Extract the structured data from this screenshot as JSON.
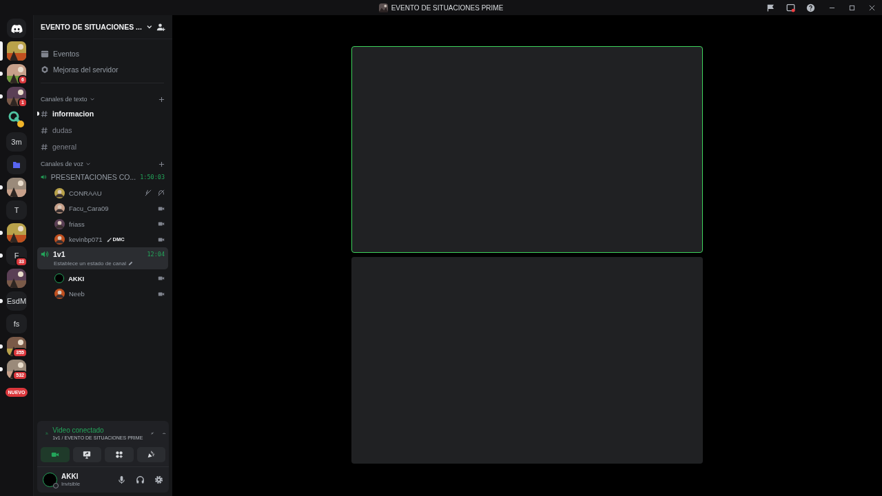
{
  "window": {
    "title": "EVENTO DE SITUACIONES PRIME"
  },
  "servers": [
    {
      "kind": "home",
      "selected": false,
      "unread": false
    },
    {
      "kind": "picture",
      "selected": true,
      "unread": false
    },
    {
      "kind": "picture",
      "selected": false,
      "unread": true,
      "badge": "6"
    },
    {
      "kind": "picture",
      "selected": false,
      "unread": true,
      "badge": "1"
    },
    {
      "kind": "pacifier",
      "selected": false,
      "unread": false
    },
    {
      "kind": "text",
      "label": "3m",
      "selected": false,
      "unread": false
    },
    {
      "kind": "folder",
      "selected": false,
      "unread": false
    },
    {
      "kind": "picture",
      "selected": false,
      "unread": true
    },
    {
      "kind": "text",
      "label": "T",
      "selected": false,
      "unread": false
    },
    {
      "kind": "picture",
      "selected": false,
      "unread": true
    },
    {
      "kind": "text",
      "label": "F",
      "selected": false,
      "unread": true,
      "badge": "33"
    },
    {
      "kind": "picture",
      "selected": false,
      "unread": false
    },
    {
      "kind": "text",
      "label": "EsdM",
      "selected": false,
      "unread": true
    },
    {
      "kind": "text",
      "label": "fs",
      "selected": false,
      "unread": false
    },
    {
      "kind": "picture",
      "selected": false,
      "unread": true,
      "badge": "355"
    },
    {
      "kind": "picture",
      "selected": false,
      "unread": true,
      "badge": "532"
    },
    {
      "kind": "new",
      "label": "NUEVO",
      "selected": false,
      "unread": false
    }
  ],
  "server_header": {
    "name": "EVENTO DE SITUACIONES ..."
  },
  "shortcuts": [
    {
      "kind": "calendar",
      "label": "Eventos"
    },
    {
      "kind": "boost",
      "label": "Mejoras del servidor"
    }
  ],
  "text_category": {
    "label": "Canales de texto"
  },
  "text_channels": [
    {
      "name": "informacion",
      "selected": true
    },
    {
      "name": "dudas",
      "selected": false
    },
    {
      "name": "general",
      "selected": false
    }
  ],
  "voice_category": {
    "label": "Canales de voz"
  },
  "voice_channels": [
    {
      "name": "PRESENTACIONES CO...",
      "timer": "1:50:03",
      "selected": false,
      "users": [
        {
          "name": "CONRAAU",
          "speaking": false,
          "self": false,
          "kind": "muted"
        },
        {
          "name": "Facu_Cara09",
          "speaking": false,
          "self": false,
          "kind": "camera"
        },
        {
          "name": "friass",
          "speaking": false,
          "self": false,
          "kind": "camera"
        },
        {
          "name": "kevinbp071",
          "speaking": false,
          "self": false,
          "kind": "camera",
          "tag": "DMC"
        }
      ]
    },
    {
      "name": "1v1",
      "timer": "12:04",
      "selected": true,
      "status": "Establece un estado de canal",
      "users": [
        {
          "name": "AKKI",
          "speaking": true,
          "self": true,
          "kind": "camera"
        },
        {
          "name": "Neeb",
          "speaking": false,
          "self": false,
          "kind": "camera"
        }
      ]
    }
  ],
  "voice_panel": {
    "title": "Video conectado",
    "subtitle": "1v1 / EVENTO DE SITUACIONES PRIME",
    "buttons": [
      {
        "kind": "camera",
        "on": true
      },
      {
        "kind": "screen",
        "on": false
      },
      {
        "kind": "activities",
        "on": false
      },
      {
        "kind": "soundboard",
        "on": false
      }
    ]
  },
  "user_panel": {
    "name": "AKKI",
    "status": "Invisible"
  },
  "tiles": [
    {
      "speaking": true
    },
    {
      "speaking": false
    }
  ]
}
